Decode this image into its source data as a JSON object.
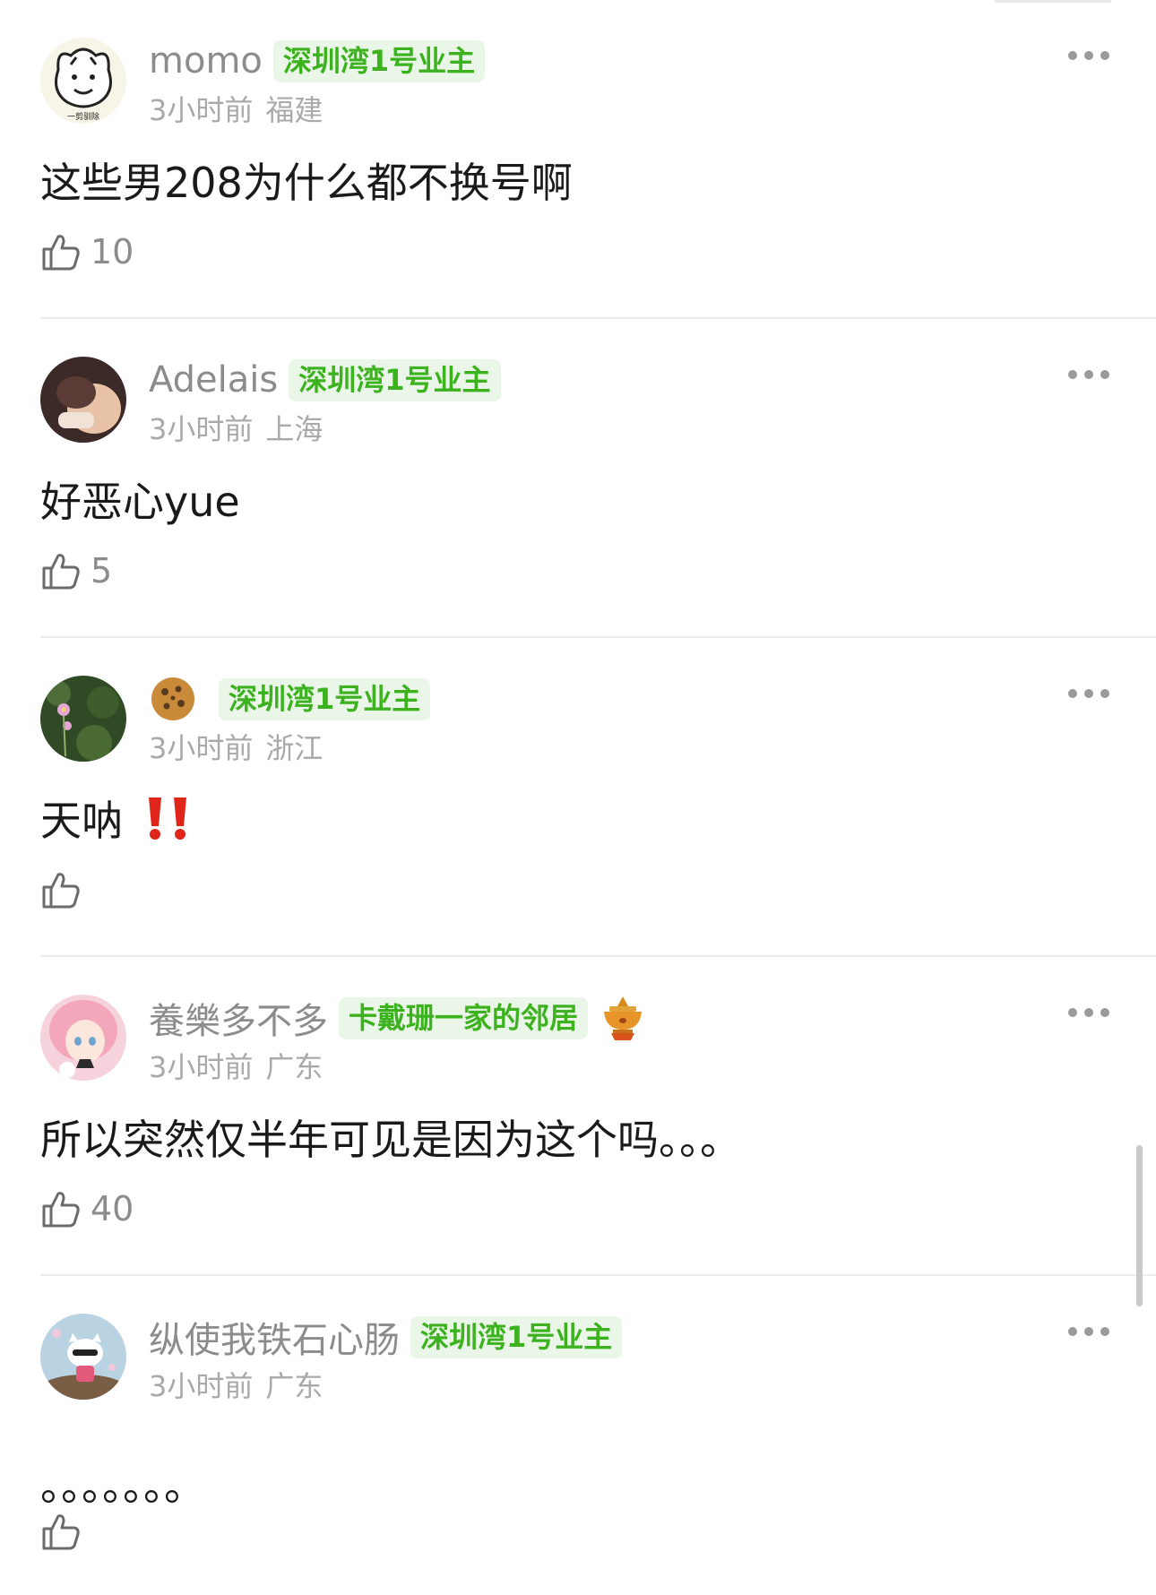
{
  "colors": {
    "badge_bg": "#eaf6e7",
    "badge_text": "#3cb21f",
    "meta": "#a9a9a9",
    "divider": "#ececec"
  },
  "comments": [
    {
      "username": "momo",
      "badge": "深圳湾1号业主",
      "time": "3小时前",
      "location": "福建",
      "text": "这些男208为什么都不换号啊",
      "likes": "10",
      "avatar_icon": "cartoon-dog-avatar",
      "avatar_caption": "一剪驯除"
    },
    {
      "username": "Adelais",
      "badge": "深圳湾1号业主",
      "time": "3小时前",
      "location": "上海",
      "text": "好恶心yue",
      "likes": "5",
      "avatar_icon": "photo-avatar"
    },
    {
      "username": "",
      "username_icon": "cookie-icon",
      "badge": "深圳湾1号业主",
      "time": "3小时前",
      "location": "浙江",
      "text": "天呐",
      "text_icon": "double-exclamation-icon",
      "likes": "",
      "avatar_icon": "flower-avatar"
    },
    {
      "username": "養樂多不多",
      "badge": "卡戴珊一家的邻居",
      "badge_icon": "hotpot-icon",
      "time": "3小时前",
      "location": "广东",
      "text": "所以突然仅半年可见是因为这个吗。。。",
      "likes": "40",
      "avatar_icon": "anime-girl-avatar"
    },
    {
      "username": "纵使我铁石心肠",
      "badge": "深圳湾1号业主",
      "time": "3小时前",
      "location": "广东",
      "text": "。。。。。。。",
      "likes": "",
      "avatar_icon": "hello-kitty-avatar"
    }
  ]
}
